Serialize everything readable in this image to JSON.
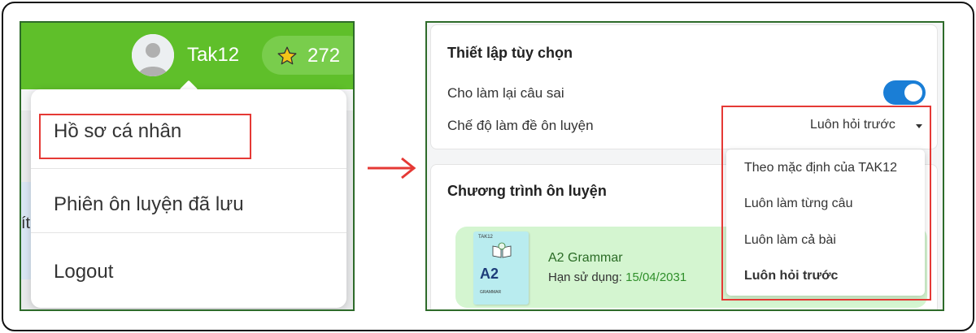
{
  "left": {
    "username": "Tak12",
    "star_count": "272",
    "star_icon": "star-icon",
    "fragment_text": "ít",
    "menu": {
      "items": [
        {
          "label": "Hồ sơ cá nhân"
        },
        {
          "label": "Phiên ôn luyện đã lưu"
        },
        {
          "label": "Logout"
        }
      ]
    },
    "highlight_color": "#e53935"
  },
  "right": {
    "settings": {
      "title": "Thiết lập tùy chọn",
      "retry_label": "Cho làm lại câu sai",
      "retry_enabled": true,
      "mode_label": "Chế độ làm đề ôn luyện",
      "mode_value": "Luôn hỏi trước",
      "options": [
        {
          "label": "Theo mặc định của TAK12"
        },
        {
          "label": "Luôn làm từng câu"
        },
        {
          "label": "Luôn làm cả bài"
        },
        {
          "label": "Luôn hỏi trước"
        }
      ]
    },
    "program": {
      "title": "Chương trình ôn luyện",
      "course": {
        "cover_brand": "TAK12",
        "cover_level": "A2",
        "cover_subtitle": "GRAMMAR",
        "name": "A2 Grammar",
        "expiry_label": "Hạn sử dụng:",
        "expiry_date": "15/04/2031"
      }
    }
  },
  "colors": {
    "header_green": "#5fbf2a",
    "toggle_blue": "#1a7ed6",
    "course_bg": "#d4f5d0",
    "arrow_red": "#e53935"
  }
}
